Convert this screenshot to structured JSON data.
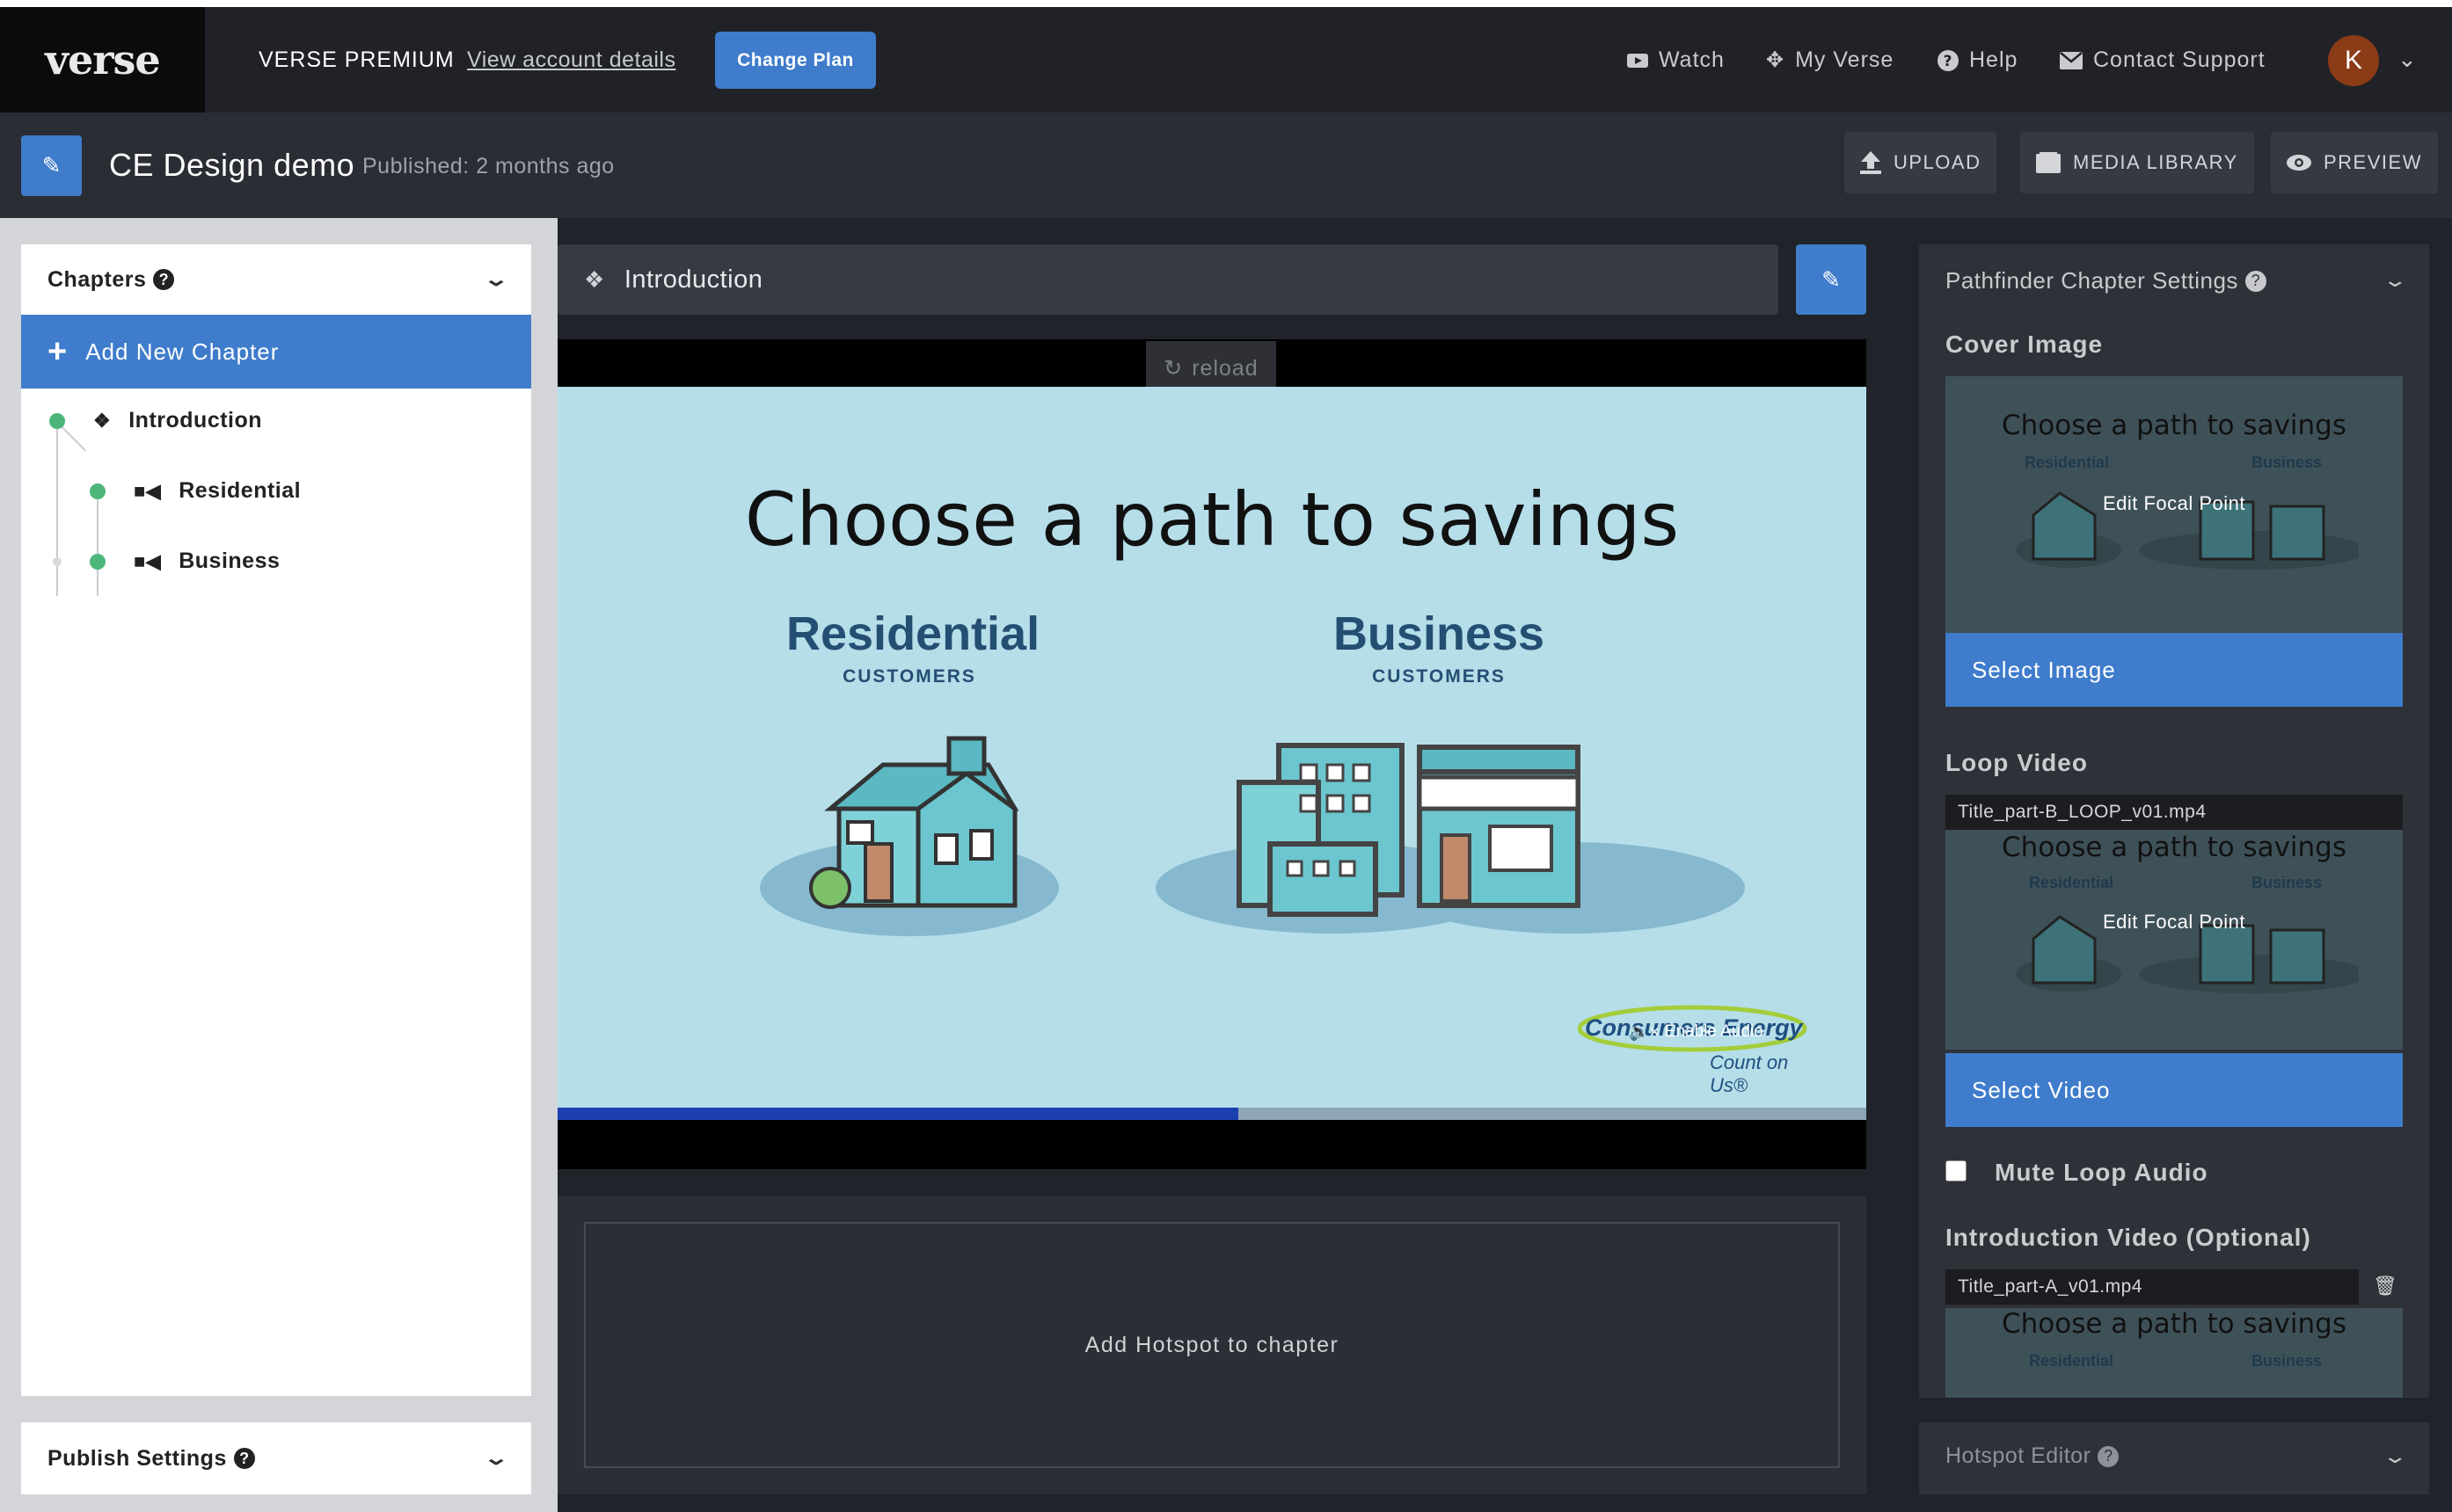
{
  "topbar": {
    "logo": "verse",
    "plan_name": "VERSE PREMIUM",
    "account_link": "View account details",
    "change_plan": "Change Plan",
    "nav": {
      "watch": "Watch",
      "my_verse": "My Verse",
      "help": "Help",
      "contact": "Contact Support"
    },
    "avatar_initial": "K"
  },
  "subbar": {
    "title": "CE Design demo",
    "published": "Published: 2 months ago",
    "upload": "UPLOAD",
    "media_library": "MEDIA LIBRARY",
    "preview": "PREVIEW"
  },
  "left": {
    "chapters_title": "Chapters",
    "add_chapter": "Add New Chapter",
    "chapters": [
      {
        "label": "Introduction"
      },
      {
        "label": "Residential"
      },
      {
        "label": "Business"
      }
    ],
    "publish_title": "Publish Settings"
  },
  "center": {
    "chapter_name": "Introduction",
    "reload": "reload",
    "slide": {
      "headline": "Choose a path to savings",
      "residential": "Residential",
      "residential_sub": "CUSTOMERS",
      "business": "Business",
      "business_sub": "CUSTOMERS",
      "brand": "Consumers Energy",
      "brand_tagline": "Count on Us®",
      "enable_audio": "Enable Audio"
    },
    "progress": 0.52,
    "hotspot_prompt": "Add Hotspot to chapter"
  },
  "right": {
    "title": "Pathfinder Chapter Settings",
    "cover_image_label": "Cover Image",
    "thumb_headline": "Choose a path to savings",
    "thumb_residential": "Residential",
    "thumb_business": "Business",
    "edit_focal": "Edit Focal Point",
    "select_image": "Select Image",
    "loop_video_label": "Loop Video",
    "loop_file": "Title_part-B_LOOP_v01.mp4",
    "select_video": "Select Video",
    "mute_loop": "Mute Loop Audio",
    "intro_video_label": "Introduction Video (Optional)",
    "intro_file": "Title_part-A_v01.mp4",
    "hotspot_editor": "Hotspot Editor"
  }
}
